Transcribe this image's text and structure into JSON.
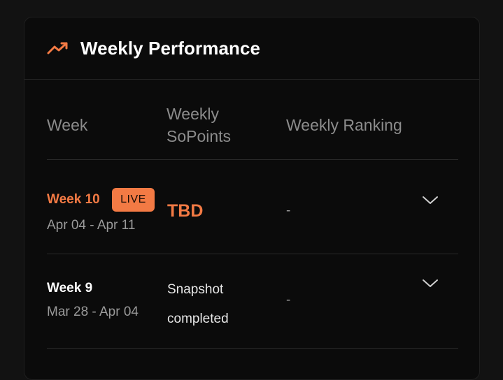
{
  "card": {
    "title": "Weekly Performance",
    "icon": "trending-up-icon",
    "accent_color": "#f37a44"
  },
  "table": {
    "headers": {
      "week": "Week",
      "points": "Weekly SoPoints",
      "ranking": "Weekly Ranking"
    },
    "rows": [
      {
        "week": "Week 10",
        "badge": "LIVE",
        "dates": "Apr 04 - Apr 11",
        "points": "TBD",
        "ranking": "-",
        "expand_icon": "chevron-down-icon"
      },
      {
        "week": "Week 9",
        "dates": "Mar 28 - Apr 04",
        "points": "Snapshot completed",
        "ranking": "-",
        "expand_icon": "chevron-down-icon"
      }
    ]
  }
}
